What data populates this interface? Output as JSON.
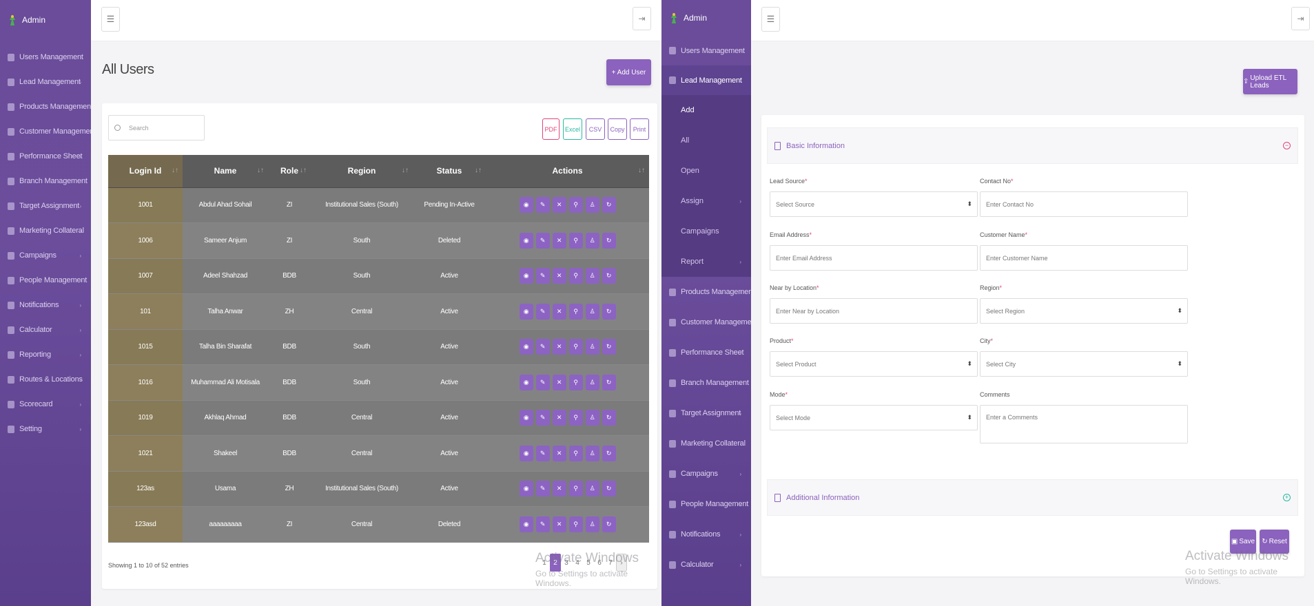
{
  "left_app": {
    "brand": "Admin",
    "sidebar": [
      {
        "label": "Users Management"
      },
      {
        "label": "Lead Management"
      },
      {
        "label": "Products Management"
      },
      {
        "label": "Customer Management"
      },
      {
        "label": "Performance Sheet"
      },
      {
        "label": "Branch Management"
      },
      {
        "label": "Target Assignment"
      },
      {
        "label": "Marketing Collateral"
      },
      {
        "label": "Campaigns"
      },
      {
        "label": "People Management"
      },
      {
        "label": "Notifications"
      },
      {
        "label": "Calculator"
      },
      {
        "label": "Reporting"
      },
      {
        "label": "Routes & Locations"
      },
      {
        "label": "Scorecard"
      },
      {
        "label": "Setting"
      }
    ],
    "page_title": "All Users",
    "add_user_label": "+ Add User",
    "search_placeholder": "Search",
    "export_buttons": [
      "PDF",
      "Excel",
      "CSV",
      "Copy",
      "Print"
    ],
    "table": {
      "columns": [
        "Login Id",
        "Name",
        "Role",
        "Region",
        "Status",
        "Actions"
      ],
      "rows": [
        [
          "1001",
          "Abdul Ahad Sohail",
          "ZI",
          "Institutional Sales (South)",
          "Pending In-Active"
        ],
        [
          "1006",
          "Sameer Anjum",
          "ZI",
          "South",
          "Deleted"
        ],
        [
          "1007",
          "Adeel Shahzad",
          "BDB",
          "South",
          "Active"
        ],
        [
          "101",
          "Talha Anwar",
          "ZH",
          "Central",
          "Active"
        ],
        [
          "1015",
          "Talha Bin Sharafat",
          "BDB",
          "South",
          "Active"
        ],
        [
          "1016",
          "Muhammad Ali Motisala",
          "BDB",
          "South",
          "Active"
        ],
        [
          "1019",
          "Akhlaq Ahmad",
          "BDB",
          "Central",
          "Active"
        ],
        [
          "1021",
          "Shakeel",
          "BDB",
          "Central",
          "Active"
        ],
        [
          "123as",
          "Usama",
          "ZH",
          "Institutional Sales (South)",
          "Active"
        ],
        [
          "123asd",
          "aaaaaaaaa",
          "ZI",
          "Central",
          "Deleted"
        ]
      ],
      "action_glyphs": [
        "◉",
        "✎",
        "✕",
        "⚲",
        "♙",
        "↻"
      ]
    },
    "footer_info": "Showing 1 to 10 of 52 entries",
    "pager": [
      "1",
      "2",
      "3",
      "4",
      "5",
      "6",
      "7",
      "›"
    ],
    "watermark_title": "Activate Windows",
    "watermark_sub": "Go to Settings to activate Windows."
  },
  "right_app": {
    "brand": "Admin",
    "sidebar_top": [
      {
        "label": "Users Management"
      },
      {
        "label": "Lead Management"
      }
    ],
    "submenu": [
      {
        "label": "Add",
        "active": true
      },
      {
        "label": "All"
      },
      {
        "label": "Open"
      },
      {
        "label": "Assign"
      },
      {
        "label": "Campaigns"
      },
      {
        "label": "Report"
      }
    ],
    "sidebar_bottom": [
      {
        "label": "Products Management"
      },
      {
        "label": "Customer Management"
      },
      {
        "label": "Performance Sheet"
      },
      {
        "label": "Branch Management"
      },
      {
        "label": "Target Assignment"
      },
      {
        "label": "Marketing Collateral"
      },
      {
        "label": "Campaigns"
      },
      {
        "label": "People Management"
      },
      {
        "label": "Notifications"
      },
      {
        "label": "Calculator"
      }
    ],
    "upload_label": "Upload ETL Leads",
    "basic_info": "Basic Information",
    "additional_info": "Additional Information",
    "form": {
      "lead_source": {
        "label": "Lead Source",
        "placeholder": "Select Source"
      },
      "contact_no": {
        "label": "Contact No",
        "placeholder": "Enter Contact No"
      },
      "email": {
        "label": "Email Address",
        "placeholder": "Enter Email Address"
      },
      "customer_name": {
        "label": "Customer Name",
        "placeholder": "Enter Customer Name"
      },
      "nearby": {
        "label": "Near by Location",
        "placeholder": "Enter Near by Location"
      },
      "region": {
        "label": "Region",
        "placeholder": "Select Region"
      },
      "product": {
        "label": "Product",
        "placeholder": "Select Product"
      },
      "city": {
        "label": "City",
        "placeholder": "Select City"
      },
      "mode": {
        "label": "Mode",
        "placeholder": "Select Mode"
      },
      "comments": {
        "label": "Comments",
        "placeholder": "Enter a Comments"
      }
    },
    "save_label": "Save",
    "reset_label": "Reset",
    "watermark_title": "Activate Windows",
    "watermark_sub": "Go to Settings to activate Windows."
  }
}
